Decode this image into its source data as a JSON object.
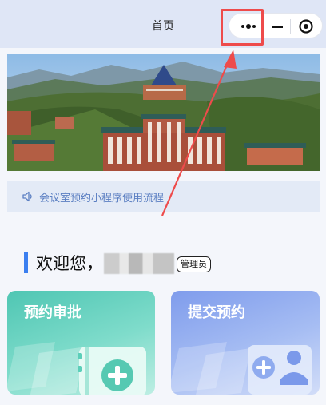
{
  "navbar": {
    "title": "首页",
    "capsule": {
      "more_icon": "more-dots-icon",
      "minimize_icon": "minimize-icon",
      "close_icon": "target-circle-icon"
    }
  },
  "banner": {
    "image_icon": "campus-photo"
  },
  "notice": {
    "icon": "speaker-icon",
    "text": "会议室预约小程序使用流程"
  },
  "welcome": {
    "greeting": "欢迎您，",
    "role_badge": "管理员"
  },
  "cards": [
    {
      "label": "预约审批",
      "icon": "document-add-icon",
      "color": "#4fc6b3"
    },
    {
      "label": "提交预约",
      "icon": "user-add-icon",
      "color": "#7f9cec"
    }
  ],
  "annotation": {
    "color": "#ee4b4b"
  }
}
